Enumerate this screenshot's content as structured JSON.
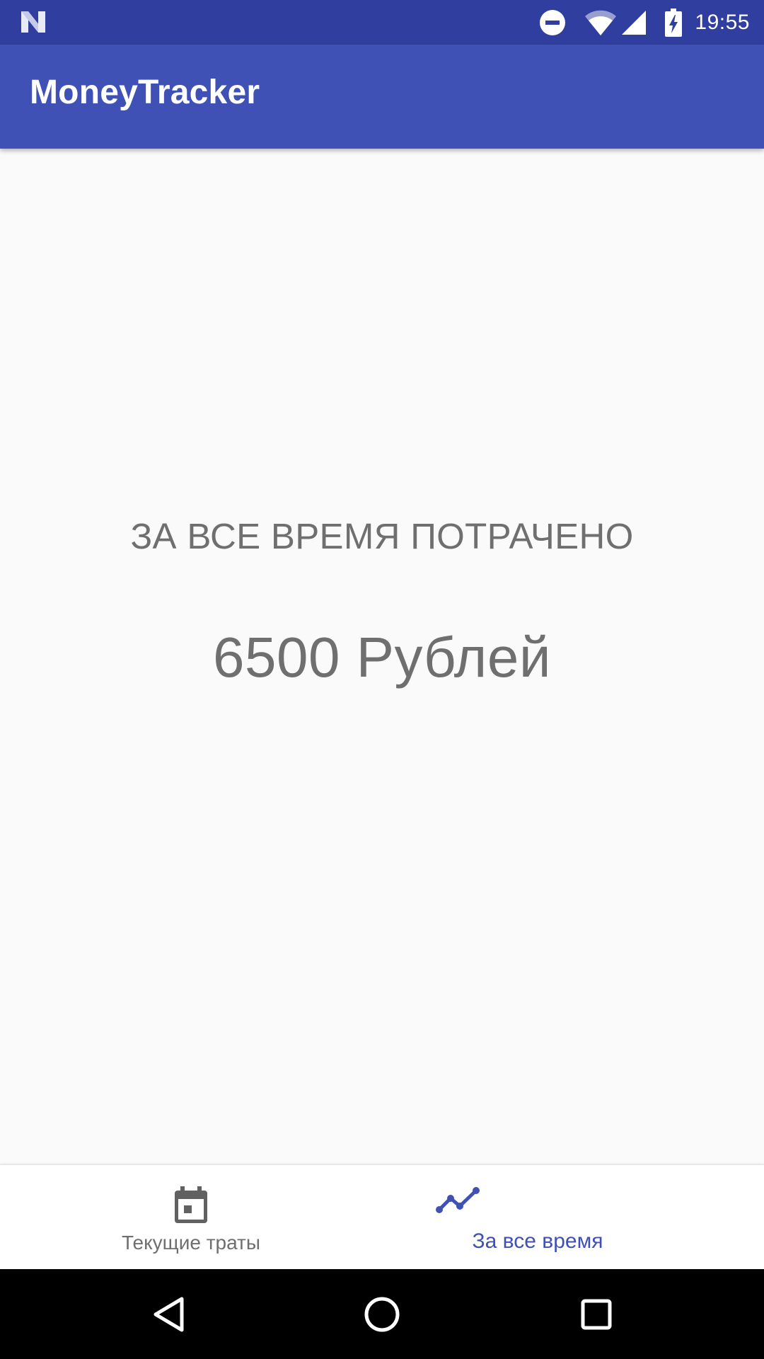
{
  "status_bar": {
    "time": "19:55",
    "icons": [
      "notification-n-logo-icon",
      "do-not-disturb-icon",
      "wifi-icon",
      "cell-signal-icon",
      "battery-charging-icon"
    ]
  },
  "app_bar": {
    "title": "MoneyTracker"
  },
  "main": {
    "spent_label": "ЗА ВСЕ ВРЕМЯ ПОТРАЧЕНО",
    "spent_value": "6500 Рублей"
  },
  "bottom_nav": {
    "items": [
      {
        "label": "Текущие траты",
        "icon": "calendar-icon",
        "selected": false
      },
      {
        "label": "За все время",
        "icon": "timeline-icon",
        "selected": true
      }
    ]
  },
  "system_nav": {
    "icons": [
      "back-icon",
      "home-icon",
      "recents-icon"
    ]
  },
  "colors": {
    "primary": "#3f51b5",
    "primary_dark": "#303f9f",
    "background": "#fafafa",
    "text_secondary": "#6f6f6f",
    "inactive_icon": "#616161"
  }
}
